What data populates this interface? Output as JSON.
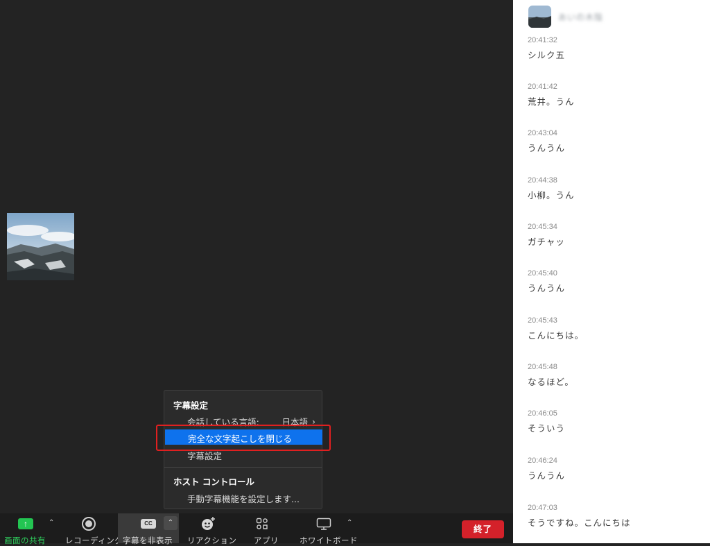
{
  "transcript": {
    "username": "あいの木陰",
    "entries": [
      {
        "time": "20:41:32",
        "text": "シルク五"
      },
      {
        "time": "20:41:42",
        "text": "荒井。うん"
      },
      {
        "time": "20:43:04",
        "text": "うんうん"
      },
      {
        "time": "20:44:38",
        "text": "小柳。うん"
      },
      {
        "time": "20:45:34",
        "text": "ガチャッ"
      },
      {
        "time": "20:45:40",
        "text": "うんうん"
      },
      {
        "time": "20:45:43",
        "text": "こんにちは。"
      },
      {
        "time": "20:45:48",
        "text": "なるほど。"
      },
      {
        "time": "20:46:05",
        "text": "そういう"
      },
      {
        "time": "20:46:24",
        "text": "うんうん"
      },
      {
        "time": "20:47:03",
        "text": "そうですね。こんにちは"
      }
    ]
  },
  "menu": {
    "caption_header": "字幕設定",
    "spoken_language_label": "会話している言語:",
    "spoken_language_value": "日本語",
    "close_transcript": "完全な文字起こしを閉じる",
    "caption_settings": "字幕設定",
    "host_controls_header": "ホスト コントロール",
    "manual_captions": "手動字幕機能を設定します..."
  },
  "toolbar": {
    "share": "画面の共有",
    "recording": "レコーディング",
    "captions": "字幕を非表示",
    "cc_icon_text": "CC",
    "reactions": "リアクション",
    "apps": "アプリ",
    "whiteboard": "ホワイトボード",
    "end": "終了"
  },
  "colors": {
    "highlight": "#0e72ed",
    "share_green": "#23c552",
    "end_red": "#d4212a",
    "callout_red": "#e02020"
  },
  "icons": [
    "share-screen-icon",
    "record-icon",
    "cc-icon",
    "reaction-icon",
    "apps-icon",
    "whiteboard-icon",
    "chevron-up-icon",
    "chevron-right-icon"
  ]
}
